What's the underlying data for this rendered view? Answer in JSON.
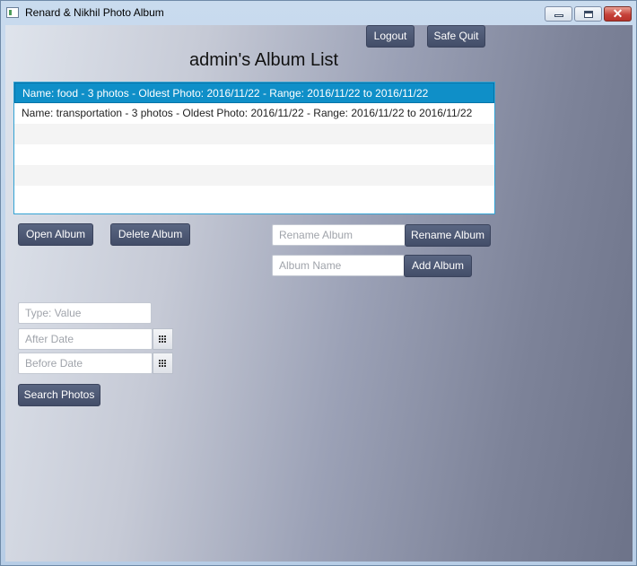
{
  "window": {
    "title": "Renard & Nikhil Photo Album",
    "controls": {
      "minimize": "minimize-icon",
      "maximize": "maximize-icon",
      "close": "close-icon"
    }
  },
  "header": {
    "logout_label": "Logout",
    "safe_quit_label": "Safe Quit",
    "title": "admin's Album List"
  },
  "albums": [
    "Name: food - 3 photos - Oldest Photo: 2016/11/22 - Range: 2016/11/22 to 2016/11/22",
    "Name: transportation - 3 photos - Oldest Photo: 2016/11/22 - Range: 2016/11/22 to 2016/11/22"
  ],
  "actions": {
    "open_label": "Open Album",
    "delete_label": "Delete Album",
    "rename_placeholder": "Rename Album",
    "rename_label": "Rename Album",
    "add_placeholder": "Album Name",
    "add_label": "Add Album"
  },
  "search": {
    "tag_placeholder": "Type: Value",
    "after_placeholder": "After Date",
    "before_placeholder": "Before Date",
    "search_label": "Search Photos",
    "calendar_icon": "calendar-icon"
  },
  "colors": {
    "button": "#4a5470",
    "selection": "#0f8fc8",
    "list_border": "#34a3d4"
  }
}
